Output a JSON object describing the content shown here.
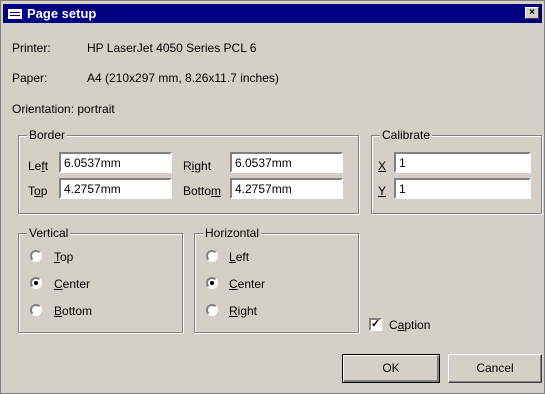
{
  "window": {
    "title": "Page setup",
    "close_glyph": "×"
  },
  "info": {
    "printer_label": "Printer:",
    "printer_value": "HP LaserJet 4050 Series PCL 6",
    "paper_label": "Paper:",
    "paper_value": "A4 (210x297 mm, 8.26x11.7 inches)",
    "orientation_text": "Orientation: portrait"
  },
  "border": {
    "title": "Border",
    "left": {
      "label_pre": "Le",
      "label_key": "f",
      "label_post": "t",
      "value": "6.0537mm"
    },
    "right": {
      "label_pre": "R",
      "label_key": "i",
      "label_post": "ght",
      "value": "6.0537mm"
    },
    "top": {
      "label_pre": "T",
      "label_key": "o",
      "label_post": "p",
      "value": "4.2757mm"
    },
    "bottom": {
      "label_pre": "Botto",
      "label_key": "m",
      "label_post": "",
      "value": "4.2757mm"
    }
  },
  "calibrate": {
    "title": "Calibrate",
    "x": {
      "label": "X",
      "value": "1"
    },
    "y": {
      "label": "Y",
      "value": "1"
    }
  },
  "vertical": {
    "title": "Vertical",
    "selected": "Center",
    "options": [
      {
        "key": "T",
        "rest": "op"
      },
      {
        "key": "C",
        "rest": "enter"
      },
      {
        "key": "B",
        "rest": "ottom"
      }
    ]
  },
  "horizontal": {
    "title": "Horizontal",
    "selected": "Center",
    "options": [
      {
        "key": "L",
        "rest": "eft"
      },
      {
        "key": "C",
        "rest": "enter"
      },
      {
        "key": "R",
        "rest": "ight"
      }
    ]
  },
  "caption": {
    "checked": true,
    "check_glyph": "✓",
    "label_pre": "C",
    "label_key": "a",
    "label_post": "ption"
  },
  "buttons": {
    "ok": "OK",
    "cancel": "Cancel"
  }
}
